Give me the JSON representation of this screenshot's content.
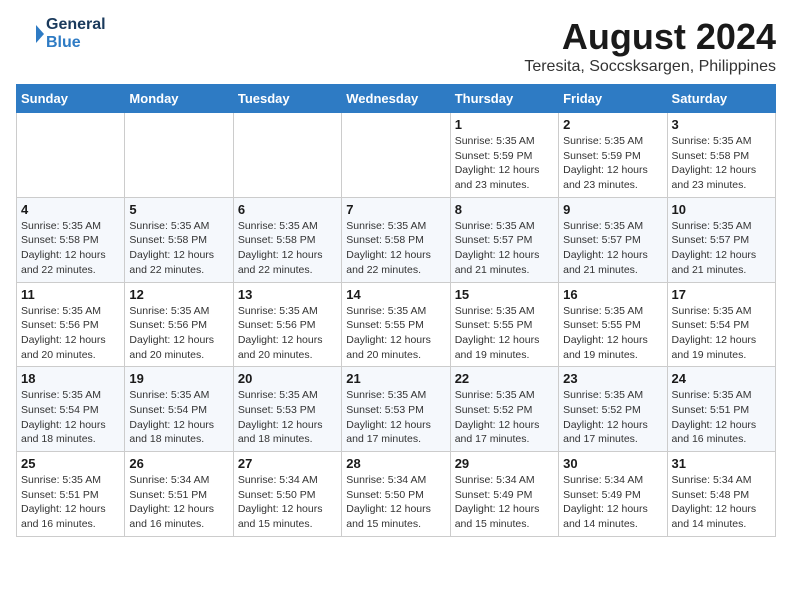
{
  "header": {
    "logo_line1": "General",
    "logo_line2": "Blue",
    "month": "August 2024",
    "location": "Teresita, Soccsksargen, Philippines"
  },
  "weekdays": [
    "Sunday",
    "Monday",
    "Tuesday",
    "Wednesday",
    "Thursday",
    "Friday",
    "Saturday"
  ],
  "weeks": [
    [
      {
        "day": "",
        "info": ""
      },
      {
        "day": "",
        "info": ""
      },
      {
        "day": "",
        "info": ""
      },
      {
        "day": "",
        "info": ""
      },
      {
        "day": "1",
        "info": "Sunrise: 5:35 AM\nSunset: 5:59 PM\nDaylight: 12 hours\nand 23 minutes."
      },
      {
        "day": "2",
        "info": "Sunrise: 5:35 AM\nSunset: 5:59 PM\nDaylight: 12 hours\nand 23 minutes."
      },
      {
        "day": "3",
        "info": "Sunrise: 5:35 AM\nSunset: 5:58 PM\nDaylight: 12 hours\nand 23 minutes."
      }
    ],
    [
      {
        "day": "4",
        "info": "Sunrise: 5:35 AM\nSunset: 5:58 PM\nDaylight: 12 hours\nand 22 minutes."
      },
      {
        "day": "5",
        "info": "Sunrise: 5:35 AM\nSunset: 5:58 PM\nDaylight: 12 hours\nand 22 minutes."
      },
      {
        "day": "6",
        "info": "Sunrise: 5:35 AM\nSunset: 5:58 PM\nDaylight: 12 hours\nand 22 minutes."
      },
      {
        "day": "7",
        "info": "Sunrise: 5:35 AM\nSunset: 5:58 PM\nDaylight: 12 hours\nand 22 minutes."
      },
      {
        "day": "8",
        "info": "Sunrise: 5:35 AM\nSunset: 5:57 PM\nDaylight: 12 hours\nand 21 minutes."
      },
      {
        "day": "9",
        "info": "Sunrise: 5:35 AM\nSunset: 5:57 PM\nDaylight: 12 hours\nand 21 minutes."
      },
      {
        "day": "10",
        "info": "Sunrise: 5:35 AM\nSunset: 5:57 PM\nDaylight: 12 hours\nand 21 minutes."
      }
    ],
    [
      {
        "day": "11",
        "info": "Sunrise: 5:35 AM\nSunset: 5:56 PM\nDaylight: 12 hours\nand 20 minutes."
      },
      {
        "day": "12",
        "info": "Sunrise: 5:35 AM\nSunset: 5:56 PM\nDaylight: 12 hours\nand 20 minutes."
      },
      {
        "day": "13",
        "info": "Sunrise: 5:35 AM\nSunset: 5:56 PM\nDaylight: 12 hours\nand 20 minutes."
      },
      {
        "day": "14",
        "info": "Sunrise: 5:35 AM\nSunset: 5:55 PM\nDaylight: 12 hours\nand 20 minutes."
      },
      {
        "day": "15",
        "info": "Sunrise: 5:35 AM\nSunset: 5:55 PM\nDaylight: 12 hours\nand 19 minutes."
      },
      {
        "day": "16",
        "info": "Sunrise: 5:35 AM\nSunset: 5:55 PM\nDaylight: 12 hours\nand 19 minutes."
      },
      {
        "day": "17",
        "info": "Sunrise: 5:35 AM\nSunset: 5:54 PM\nDaylight: 12 hours\nand 19 minutes."
      }
    ],
    [
      {
        "day": "18",
        "info": "Sunrise: 5:35 AM\nSunset: 5:54 PM\nDaylight: 12 hours\nand 18 minutes."
      },
      {
        "day": "19",
        "info": "Sunrise: 5:35 AM\nSunset: 5:54 PM\nDaylight: 12 hours\nand 18 minutes."
      },
      {
        "day": "20",
        "info": "Sunrise: 5:35 AM\nSunset: 5:53 PM\nDaylight: 12 hours\nand 18 minutes."
      },
      {
        "day": "21",
        "info": "Sunrise: 5:35 AM\nSunset: 5:53 PM\nDaylight: 12 hours\nand 17 minutes."
      },
      {
        "day": "22",
        "info": "Sunrise: 5:35 AM\nSunset: 5:52 PM\nDaylight: 12 hours\nand 17 minutes."
      },
      {
        "day": "23",
        "info": "Sunrise: 5:35 AM\nSunset: 5:52 PM\nDaylight: 12 hours\nand 17 minutes."
      },
      {
        "day": "24",
        "info": "Sunrise: 5:35 AM\nSunset: 5:51 PM\nDaylight: 12 hours\nand 16 minutes."
      }
    ],
    [
      {
        "day": "25",
        "info": "Sunrise: 5:35 AM\nSunset: 5:51 PM\nDaylight: 12 hours\nand 16 minutes."
      },
      {
        "day": "26",
        "info": "Sunrise: 5:34 AM\nSunset: 5:51 PM\nDaylight: 12 hours\nand 16 minutes."
      },
      {
        "day": "27",
        "info": "Sunrise: 5:34 AM\nSunset: 5:50 PM\nDaylight: 12 hours\nand 15 minutes."
      },
      {
        "day": "28",
        "info": "Sunrise: 5:34 AM\nSunset: 5:50 PM\nDaylight: 12 hours\nand 15 minutes."
      },
      {
        "day": "29",
        "info": "Sunrise: 5:34 AM\nSunset: 5:49 PM\nDaylight: 12 hours\nand 15 minutes."
      },
      {
        "day": "30",
        "info": "Sunrise: 5:34 AM\nSunset: 5:49 PM\nDaylight: 12 hours\nand 14 minutes."
      },
      {
        "day": "31",
        "info": "Sunrise: 5:34 AM\nSunset: 5:48 PM\nDaylight: 12 hours\nand 14 minutes."
      }
    ]
  ]
}
